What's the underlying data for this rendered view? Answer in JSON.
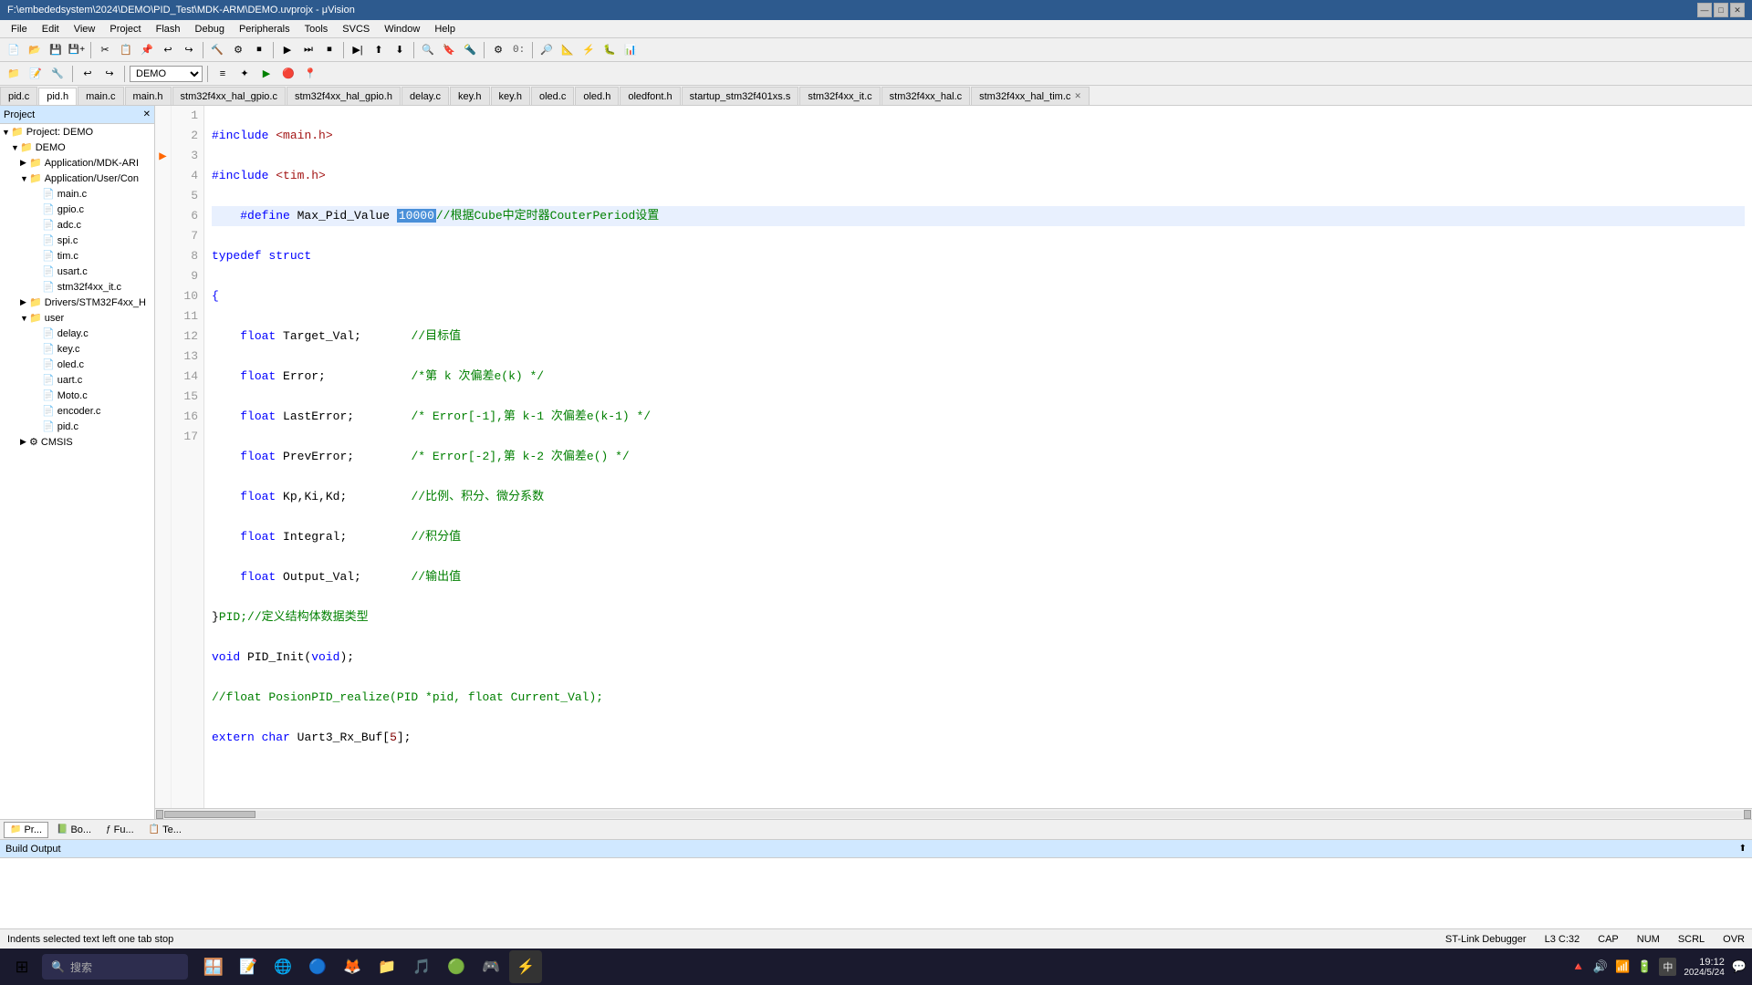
{
  "window": {
    "title": "F:\\embededsystem\\2024\\DEMO\\PID_Test\\MDK-ARM\\DEMO.uvprojx - μVision",
    "min": "—",
    "max": "□",
    "close": "✕"
  },
  "menu": {
    "items": [
      "File",
      "Edit",
      "View",
      "Project",
      "Flash",
      "Debug",
      "Peripherals",
      "Tools",
      "SVCS",
      "Window",
      "Help"
    ]
  },
  "toolbar": {
    "target_combo": "DEMO"
  },
  "tabs": [
    {
      "label": "pid.c",
      "active": false,
      "closeable": false
    },
    {
      "label": "pid.h",
      "active": true,
      "closeable": false
    },
    {
      "label": "main.c",
      "active": false,
      "closeable": false
    },
    {
      "label": "main.h",
      "active": false,
      "closeable": false
    },
    {
      "label": "stm32f4xx_hal_gpio.c",
      "active": false,
      "closeable": false
    },
    {
      "label": "stm32f4xx_hal_gpio.h",
      "active": false,
      "closeable": false
    },
    {
      "label": "delay.c",
      "active": false,
      "closeable": false
    },
    {
      "label": "key.h",
      "active": false,
      "closeable": false
    },
    {
      "label": "key.h",
      "active": false,
      "closeable": false
    },
    {
      "label": "oled.c",
      "active": false,
      "closeable": false
    },
    {
      "label": "oled.h",
      "active": false,
      "closeable": false
    },
    {
      "label": "oledfont.h",
      "active": false,
      "closeable": false
    },
    {
      "label": "startup_stm32f401xs.s",
      "active": false,
      "closeable": false
    },
    {
      "label": "stm32f4xx_it.c",
      "active": false,
      "closeable": false
    },
    {
      "label": "stm32f4xx_hal.c",
      "active": false,
      "closeable": false
    },
    {
      "label": "stm32f4xx_hal_tim.c",
      "active": false,
      "closeable": true
    }
  ],
  "project": {
    "header": "Project",
    "tree": [
      {
        "id": "root",
        "label": "Project: DEMO",
        "level": 0,
        "expanded": true,
        "icon": "folder"
      },
      {
        "id": "demo",
        "label": "DEMO",
        "level": 1,
        "expanded": true,
        "icon": "folder"
      },
      {
        "id": "app-mdk",
        "label": "Application/MDK-ARI",
        "level": 2,
        "expanded": false,
        "icon": "folder"
      },
      {
        "id": "app-user",
        "label": "Application/User/Con",
        "level": 2,
        "expanded": true,
        "icon": "folder"
      },
      {
        "id": "main-c",
        "label": "main.c",
        "level": 3,
        "icon": "file"
      },
      {
        "id": "gpio-c",
        "label": "gpio.c",
        "level": 3,
        "icon": "file"
      },
      {
        "id": "adc-c",
        "label": "adc.c",
        "level": 3,
        "icon": "file"
      },
      {
        "id": "spi-c",
        "label": "spi.c",
        "level": 3,
        "icon": "file"
      },
      {
        "id": "tim-c",
        "label": "tim.c",
        "level": 3,
        "icon": "file"
      },
      {
        "id": "usart-c",
        "label": "usart.c",
        "level": 3,
        "icon": "file"
      },
      {
        "id": "stm32-it-c",
        "label": "stm32f4xx_it.c",
        "level": 3,
        "icon": "file"
      },
      {
        "id": "drivers-hal",
        "label": "Drivers/STM32F4xx_H",
        "level": 2,
        "expanded": false,
        "icon": "folder"
      },
      {
        "id": "user",
        "label": "user",
        "level": 2,
        "expanded": true,
        "icon": "folder"
      },
      {
        "id": "delay-c",
        "label": "delay.c",
        "level": 3,
        "icon": "file"
      },
      {
        "id": "key-c",
        "label": "key.c",
        "level": 3,
        "icon": "file"
      },
      {
        "id": "oled-c",
        "label": "oled.c",
        "level": 3,
        "icon": "file"
      },
      {
        "id": "uart-c",
        "label": "uart.c",
        "level": 3,
        "icon": "file"
      },
      {
        "id": "moto-c",
        "label": "Moto.c",
        "level": 3,
        "icon": "file"
      },
      {
        "id": "encoder-c",
        "label": "encoder.c",
        "level": 3,
        "icon": "file"
      },
      {
        "id": "pid-c",
        "label": "pid.c",
        "level": 3,
        "icon": "file"
      },
      {
        "id": "cmsis",
        "label": "CMSIS",
        "level": 2,
        "expanded": false,
        "icon": "folder-gear"
      }
    ]
  },
  "code": {
    "lines": [
      {
        "num": 1,
        "arrow": false,
        "content": "#include <main.h>",
        "type": "preprocessor"
      },
      {
        "num": 2,
        "arrow": false,
        "content": "#include <tim.h>",
        "type": "preprocessor"
      },
      {
        "num": 3,
        "arrow": true,
        "content": "    #define Max_Pid_Value [10000]//根据Cube中定时器CouterPeriod设置",
        "type": "define"
      },
      {
        "num": 4,
        "arrow": false,
        "content": "typedef struct",
        "type": "code"
      },
      {
        "num": 5,
        "arrow": false,
        "content": "{",
        "type": "code"
      },
      {
        "num": 6,
        "arrow": false,
        "content": "    float Target_Val;       //目标值",
        "type": "code"
      },
      {
        "num": 7,
        "arrow": false,
        "content": "    float Error;            /*第 k 次偏差e(k) */",
        "type": "code"
      },
      {
        "num": 8,
        "arrow": false,
        "content": "    float LastError;        /* Error[-1],第 k-1 次偏差e(k-1) */",
        "type": "code"
      },
      {
        "num": 9,
        "arrow": false,
        "content": "    float PrevError;        /* Error[-2],第 k-2 次偏差e() */",
        "type": "code"
      },
      {
        "num": 10,
        "arrow": false,
        "content": "    float Kp,Ki,Kd;         //比例、积分、微分系数",
        "type": "code"
      },
      {
        "num": 11,
        "arrow": false,
        "content": "    float Integral;         //积分值",
        "type": "code"
      },
      {
        "num": 12,
        "arrow": false,
        "content": "    float Output_Val;       //输出值",
        "type": "code"
      },
      {
        "num": 13,
        "arrow": false,
        "content": "}PID;//定义结构体数据类型",
        "type": "code"
      },
      {
        "num": 14,
        "arrow": false,
        "content": "void PID_Init(void);",
        "type": "code"
      },
      {
        "num": 15,
        "arrow": false,
        "content": "//float PosionPID_realize(PID *pid, float Current_Val);",
        "type": "comment"
      },
      {
        "num": 16,
        "arrow": false,
        "content": "extern char Uart3_Rx_Buf[5];",
        "type": "code"
      },
      {
        "num": 17,
        "arrow": false,
        "content": "",
        "type": "empty"
      }
    ]
  },
  "bottom_tabs": [
    {
      "label": "▷ Pr...",
      "active": false,
      "icon": "project-icon"
    },
    {
      "label": "Bo...",
      "active": false,
      "icon": "book-icon"
    },
    {
      "label": "Fu...",
      "active": false,
      "icon": "function-icon"
    },
    {
      "label": "Te...",
      "active": false,
      "icon": "template-icon"
    }
  ],
  "build_output": {
    "header": "Build Output",
    "content": ""
  },
  "status": {
    "left": "Indents selected text left one tab stop",
    "debugger": "ST-Link Debugger",
    "location": "L3 C:32",
    "caps": "CAP",
    "num": "NUM",
    "scrl": "SCRL",
    "ovr": "OVR"
  },
  "taskbar": {
    "time": "19:12",
    "date": "2024/5/24",
    "start_label": "⊞",
    "search_placeholder": "搜索",
    "apps": [
      {
        "icon": "🪟",
        "label": ""
      },
      {
        "icon": "🔍",
        "label": "搜索"
      },
      {
        "icon": "📝",
        "label": ""
      },
      {
        "icon": "🌐",
        "label": ""
      },
      {
        "icon": "🔵",
        "label": ""
      },
      {
        "icon": "🦊",
        "label": ""
      },
      {
        "icon": "📁",
        "label": ""
      },
      {
        "icon": "🎵",
        "label": ""
      },
      {
        "icon": "🔧",
        "label": ""
      },
      {
        "icon": "🎮",
        "label": ""
      }
    ]
  }
}
